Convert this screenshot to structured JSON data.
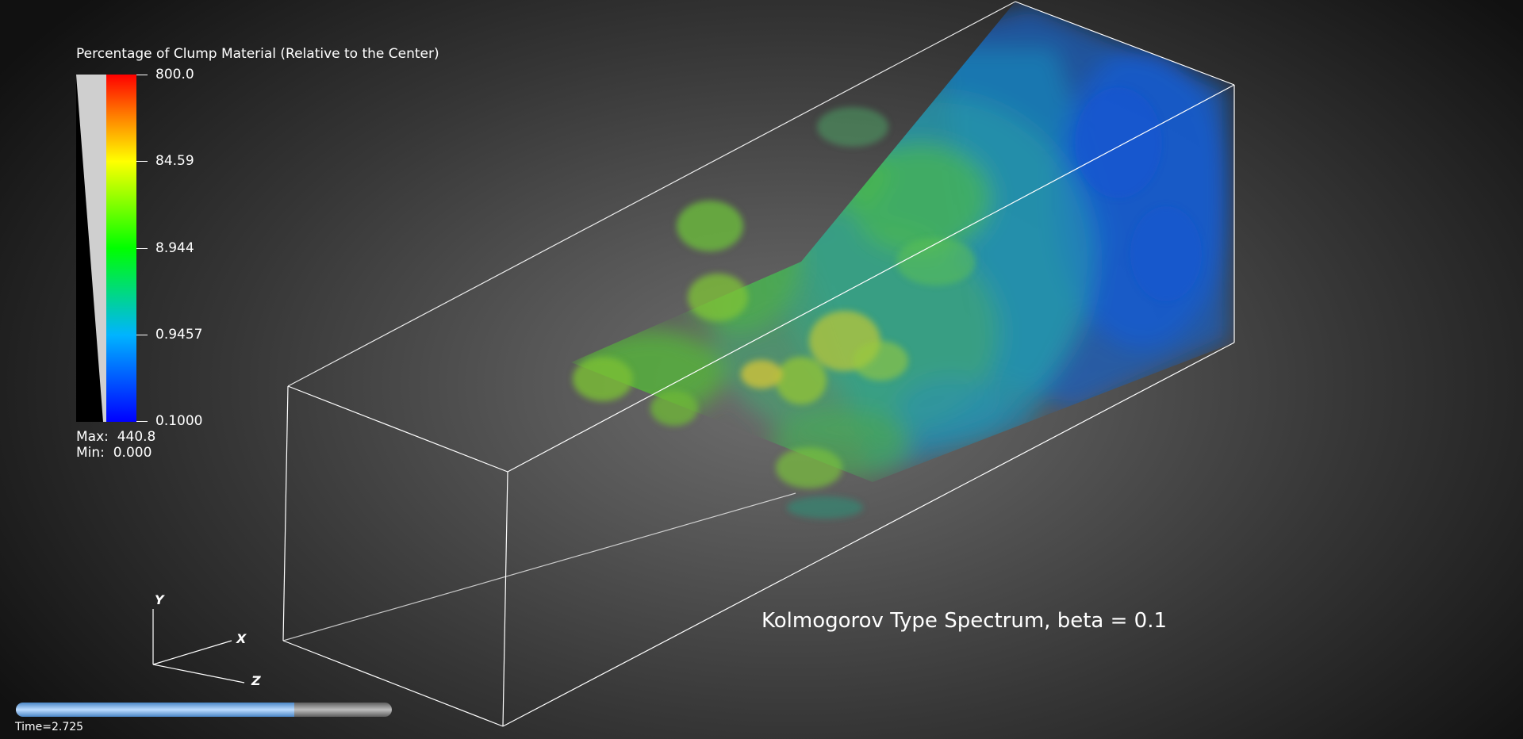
{
  "legend": {
    "title": "Percentage of Clump Material (Relative to the Center)",
    "ticks": [
      "800.0",
      "84.59",
      "8.944",
      "0.9457",
      "0.1000"
    ],
    "max_label": "Max:",
    "max_value": "440.8",
    "min_label": "Min:",
    "min_value": "0.000",
    "colormap": [
      "#0000ff",
      "#00b4ff",
      "#00ff00",
      "#ffff00",
      "#ff8000",
      "#ff0000"
    ]
  },
  "caption": "Kolmogorov Type Spectrum, beta = 0.1",
  "axes": {
    "x": "X",
    "y": "Y",
    "z": "Z"
  },
  "time": {
    "label": "Time=2.725",
    "progress": 0.74
  }
}
